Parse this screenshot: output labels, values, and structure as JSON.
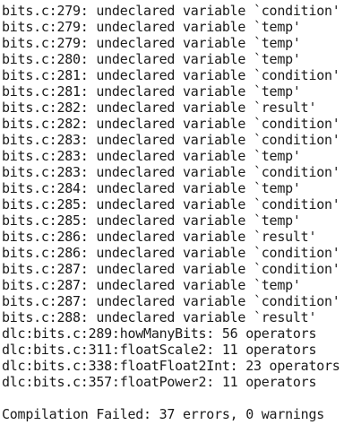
{
  "terminal": {
    "lines": [
      "bits.c:279: undeclared variable `condition'",
      "bits.c:279: undeclared variable `temp'",
      "bits.c:279: undeclared variable `temp'",
      "bits.c:280: undeclared variable `temp'",
      "bits.c:281: undeclared variable `condition'",
      "bits.c:281: undeclared variable `temp'",
      "bits.c:282: undeclared variable `result'",
      "bits.c:282: undeclared variable `condition'",
      "bits.c:283: undeclared variable `condition'",
      "bits.c:283: undeclared variable `temp'",
      "bits.c:283: undeclared variable `condition'",
      "bits.c:284: undeclared variable `temp'",
      "bits.c:285: undeclared variable `condition'",
      "bits.c:285: undeclared variable `temp'",
      "bits.c:286: undeclared variable `result'",
      "bits.c:286: undeclared variable `condition'",
      "bits.c:287: undeclared variable `condition'",
      "bits.c:287: undeclared variable `temp'",
      "bits.c:287: undeclared variable `condition'",
      "bits.c:288: undeclared variable `result'",
      "dlc:bits.c:289:howManyBits: 56 operators",
      "dlc:bits.c:311:floatScale2: 11 operators",
      "dlc:bits.c:338:floatFloat2Int: 23 operators",
      "dlc:bits.c:357:floatPower2: 11 operators",
      "",
      "Compilation Failed: 37 errors, 0 warnings"
    ]
  }
}
